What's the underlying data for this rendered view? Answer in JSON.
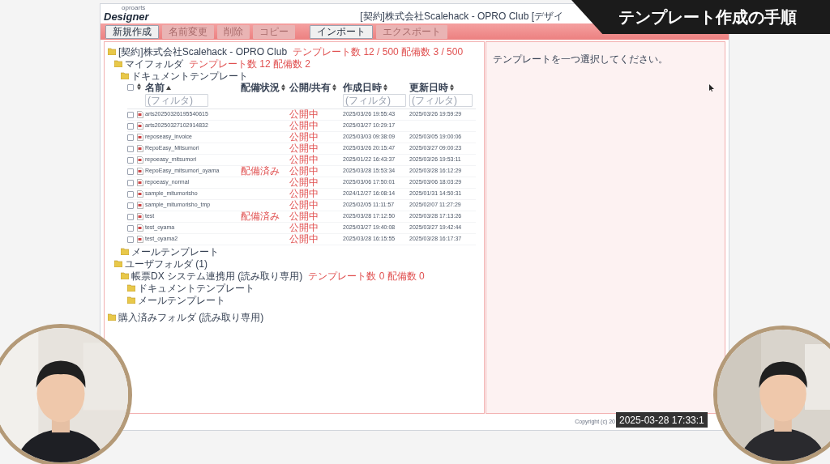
{
  "app": {
    "logo_brand": "oproarts",
    "logo": "Designer",
    "title": "[契約]株式会社Scalehack - OPRO Club [デザイ"
  },
  "toolbar": [
    {
      "buttons": [
        {
          "label": "新規作成",
          "disabled": false
        },
        {
          "label": "名前変更",
          "disabled": true
        },
        {
          "label": "削除",
          "disabled": true
        },
        {
          "label": "コピー",
          "disabled": true
        }
      ]
    },
    {
      "buttons": [
        {
          "label": "インポート",
          "disabled": false
        },
        {
          "label": "エクスポート",
          "disabled": true
        }
      ]
    }
  ],
  "tree": [
    {
      "label": "[契約]株式会社Scalehack - OPRO Club",
      "note": "テンプレート数 12 / 500  配備数 3 / 500",
      "children": [
        {
          "label": "マイフォルダ",
          "note": "テンプレート数 12  配備数 2",
          "children": [
            {
              "label": "ドキュメントテンプレート",
              "table": {
                "columns": [
                  {
                    "kind": "check",
                    "checked": false
                  },
                  {
                    "kind": "sort",
                    "sorted": false
                  },
                  {
                    "kind": "text",
                    "label": "名前",
                    "placeholder": "(フィルタ)",
                    "sorted": true
                  },
                  {
                    "kind": "text",
                    "label": "配備状況",
                    "sorted": false
                  },
                  {
                    "kind": "text",
                    "label": "公開/共有",
                    "sorted": false
                  },
                  {
                    "kind": "text",
                    "label": "作成日時",
                    "placeholder": "(フィルタ)",
                    "sorted": false
                  },
                  {
                    "kind": "text",
                    "label": "更新日時",
                    "placeholder": "(フィルタ)",
                    "sorted": false
                  }
                ],
                "rows": [
                  {
                    "checked": false,
                    "name": "arts20250326195540615",
                    "public": "公開中",
                    "created": "2025/03/26 19:55:43",
                    "updated": "2025/03/26 19:59:29"
                  },
                  {
                    "checked": false,
                    "name": "arts20250327102914832",
                    "public": "公開中",
                    "created": "2025/03/27 10:29:17"
                  },
                  {
                    "checked": false,
                    "name": "reposeasy_invoice",
                    "public": "公開中",
                    "created": "2025/03/03 09:38:09",
                    "updated": "2025/03/05 19:00:06"
                  },
                  {
                    "checked": false,
                    "name": "RepoEasy_Mitsumori",
                    "public": "公開中",
                    "created": "2025/03/26 20:15:47",
                    "updated": "2025/03/27 09:00:23"
                  },
                  {
                    "checked": false,
                    "name": "repoeasy_mitsumori",
                    "public": "公開中",
                    "created": "2025/01/22 16:43:37",
                    "updated": "2025/03/26 19:53:11"
                  },
                  {
                    "checked": false,
                    "name": "RepoEasy_mitsumori_oyama",
                    "deploy": "配備済み",
                    "public": "公開中",
                    "created": "2025/03/28 15:53:34",
                    "updated": "2025/03/28 16:12:29"
                  },
                  {
                    "checked": false,
                    "name": "repoeasy_normal",
                    "public": "公開中",
                    "created": "2025/03/06 17:50:01",
                    "updated": "2025/03/06 18:03:29"
                  },
                  {
                    "checked": false,
                    "name": "sample_mitumorisho",
                    "public": "公開中",
                    "created": "2024/12/27 16:08:14",
                    "updated": "2025/01/31 14:50:31"
                  },
                  {
                    "checked": false,
                    "name": "sample_mitumorisho_tmp",
                    "public": "公開中",
                    "created": "2025/02/05 11:11:57",
                    "updated": "2025/02/07 11:27:29"
                  },
                  {
                    "checked": false,
                    "name": "test",
                    "deploy": "配備済み",
                    "public": "公開中",
                    "created": "2025/03/28 17:12:50",
                    "updated": "2025/03/28 17:13:26"
                  },
                  {
                    "checked": false,
                    "name": "test_oyama",
                    "public": "公開中",
                    "created": "2025/03/27 19:40:08",
                    "updated": "2025/03/27 19:42:44"
                  },
                  {
                    "checked": false,
                    "name": "test_oyama2",
                    "public": "公開中",
                    "created": "2025/03/28 16:15:55",
                    "updated": "2025/03/28 16:17:37"
                  }
                ]
              }
            },
            {
              "label": "メールテンプレート"
            }
          ]
        },
        {
          "label": "ユーザフォルダ (1)",
          "children": [
            {
              "label": "帳票DX システム連携用 (読み取り専用)",
              "note": "テンプレート数 0  配備数 0",
              "children": [
                {
                  "label": "ドキュメントテンプレート"
                },
                {
                  "label": "メールテンプレート"
                }
              ]
            }
          ]
        }
      ]
    },
    {
      "label": "購入済みフォルダ (読み取り専用)"
    }
  ],
  "detail": {
    "message": "テンプレートを一つ選択してください。"
  },
  "footer": {
    "copyright": "Copyright (c) 20"
  },
  "overlay": {
    "banner": "テンプレート作成の手順",
    "timestamp": "2025-03-28 17:33:1"
  }
}
